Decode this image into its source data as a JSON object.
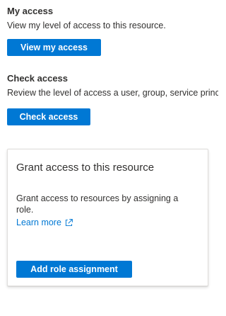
{
  "my_access": {
    "title": "My access",
    "description": "View my level of access to this resource.",
    "button_label": "View my access"
  },
  "check_access": {
    "title": "Check access",
    "description": "Review the level of access a user, group, service principal",
    "button_label": "Check access"
  },
  "grant_card": {
    "title": "Grant access to this resource",
    "description": "Grant access to resources by assigning a role.",
    "link_label": "Learn more",
    "link_icon": "external-link-icon",
    "button_label": "Add role assignment"
  },
  "colors": {
    "accent": "#0078d4",
    "text": "#323130",
    "card_border": "#e1dfdd"
  }
}
